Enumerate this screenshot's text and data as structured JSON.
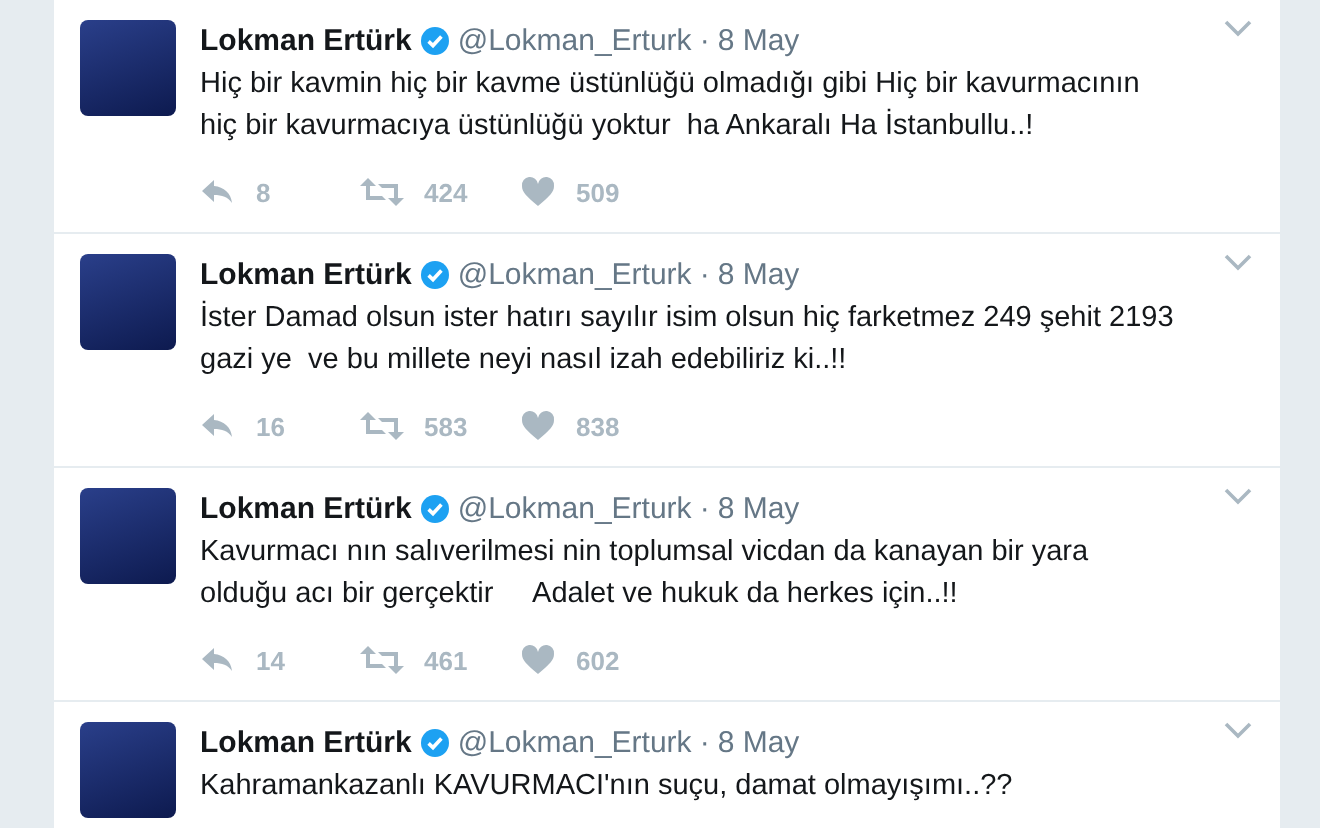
{
  "tweets": [
    {
      "name": "Lokman Ertürk",
      "verified": true,
      "handle": "@Lokman_Erturk",
      "separator": "·",
      "date": "8 May",
      "text": "Hiç bir kavmin hiç bir kavme üstünlüğü olmadığı gibi Hiç bir kavurmacının hiç bir kavurmacıya üstünlüğü yoktur  ha Ankaralı Ha İstanbullu..!",
      "replies": "8",
      "retweets": "424",
      "likes": "509"
    },
    {
      "name": "Lokman Ertürk",
      "verified": true,
      "handle": "@Lokman_Erturk",
      "separator": "·",
      "date": "8 May",
      "text": "İster Damad olsun ister hatırı sayılır isim olsun hiç farketmez 249 şehit 2193 gazi ye  ve bu millete neyi nasıl izah edebiliriz ki..!!",
      "replies": "16",
      "retweets": "583",
      "likes": "838"
    },
    {
      "name": "Lokman Ertürk",
      "verified": true,
      "handle": "@Lokman_Erturk",
      "separator": "·",
      "date": "8 May",
      "text": "Kavurmacı nın salıverilmesi nin toplumsal vicdan da kanayan bir yara olduğu acı bir gerçektir     Adalet ve hukuk da herkes için..!!",
      "replies": "14",
      "retweets": "461",
      "likes": "602"
    },
    {
      "name": "Lokman Ertürk",
      "verified": true,
      "handle": "@Lokman_Erturk",
      "separator": "·",
      "date": "8 May",
      "text": "Kahramankazanlı KAVURMACI'nın suçu, damat olmayışımı..??"
    }
  ]
}
